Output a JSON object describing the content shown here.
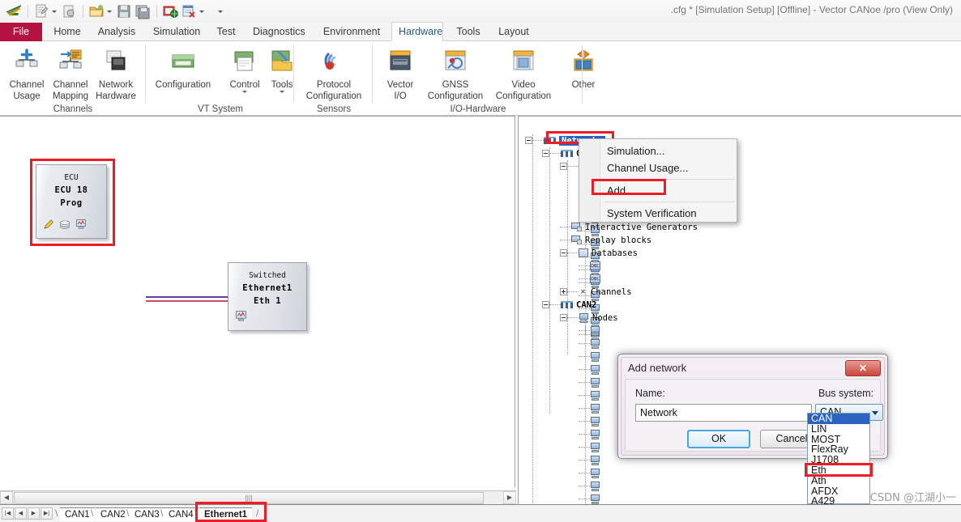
{
  "window": {
    "title": ".cfg * [Simulation Setup] [Offline] - Vector CANoe /pro (View Only)"
  },
  "quick_access": {
    "icons": [
      {
        "name": "canoe-logo-icon",
        "glyph": "✈"
      },
      {
        "name": "new-config-icon",
        "glyph": "▤"
      },
      {
        "name": "new-config-dropdown-icon",
        "glyph": "▾"
      },
      {
        "name": "open-recent-icon",
        "glyph": "◍"
      },
      {
        "name": "open-folder-icon",
        "glyph": "📂"
      },
      {
        "name": "open-dropdown-icon",
        "glyph": "▾"
      },
      {
        "name": "save-icon",
        "glyph": "💾"
      },
      {
        "name": "save-all-icon",
        "glyph": "🖫"
      },
      {
        "name": "save-as-icon",
        "glyph": "🗔"
      },
      {
        "name": "print-icon",
        "glyph": "🖨"
      },
      {
        "name": "print-dropdown-icon",
        "glyph": "▾"
      },
      {
        "name": "customize-qat-icon",
        "glyph": "▾"
      }
    ]
  },
  "ribbon": {
    "tabs": [
      {
        "label": "File",
        "kind": "file"
      },
      {
        "label": "Home",
        "kind": "normal"
      },
      {
        "label": "Analysis",
        "kind": "normal"
      },
      {
        "label": "Simulation",
        "kind": "normal"
      },
      {
        "label": "Test",
        "kind": "normal"
      },
      {
        "label": "Diagnostics",
        "kind": "normal"
      },
      {
        "label": "Environment",
        "kind": "normal"
      },
      {
        "label": "Hardware",
        "kind": "active"
      },
      {
        "label": "Tools",
        "kind": "normal"
      },
      {
        "label": "Layout",
        "kind": "normal"
      }
    ],
    "groups": [
      {
        "caption": "Channels",
        "buttons": [
          {
            "label_line1": "Channel",
            "label_line2": "Usage",
            "icon": "channel-usage-icon",
            "has_caret": false
          },
          {
            "label_line1": "Channel",
            "label_line2": "Mapping",
            "icon": "channel-mapping-icon",
            "has_caret": false
          },
          {
            "label_line1": "Network",
            "label_line2": "Hardware",
            "icon": "network-hardware-icon",
            "has_caret": false
          }
        ]
      },
      {
        "caption": "VT System",
        "buttons": [
          {
            "label_line1": "Configuration",
            "label_line2": "",
            "icon": "vt-configuration-icon",
            "has_caret": false
          },
          {
            "label_line1": "Control",
            "label_line2": "",
            "icon": "vt-control-icon",
            "has_caret": true
          },
          {
            "label_line1": "Tools",
            "label_line2": "",
            "icon": "vt-tools-icon",
            "has_caret": true
          }
        ]
      },
      {
        "caption": "Sensors",
        "buttons": [
          {
            "label_line1": "Protocol",
            "label_line2": "Configuration",
            "icon": "protocol-configuration-icon",
            "has_caret": false
          }
        ]
      },
      {
        "caption": "I/O-Hardware",
        "buttons": [
          {
            "label_line1": "Vector",
            "label_line2": "I/O",
            "icon": "vector-io-icon",
            "has_caret": false
          },
          {
            "label_line1": "GNSS",
            "label_line2": "Configuration",
            "icon": "gnss-configuration-icon",
            "has_caret": false
          },
          {
            "label_line1": "Video",
            "label_line2": "Configuration",
            "icon": "video-configuration-icon",
            "has_caret": false
          },
          {
            "label_line1": "Other",
            "label_line2": "",
            "icon": "other-io-icon",
            "has_caret": false
          }
        ]
      }
    ]
  },
  "canvas": {
    "blocks": [
      {
        "name": "ecu-block",
        "line1": "ECU",
        "line2": "ECU 18",
        "line3": "Prog",
        "icons": [
          "pencil-icon",
          "layers-icon",
          "measurement-icon"
        ],
        "highlighted": true
      },
      {
        "name": "ethernet-block",
        "line1": "Switched",
        "line2": "Ethernet1",
        "line3": "Eth 1",
        "icons": [
          "measurement-icon"
        ],
        "highlighted": false
      }
    ]
  },
  "tree": {
    "root": {
      "label": "Networks",
      "selected": true,
      "icon": "network-icon"
    },
    "nodes": [
      {
        "label": "CAN1",
        "icon": "network-icon",
        "depth": 1,
        "bold": true
      },
      {
        "label": "Nodes",
        "icon": "pc-icon",
        "depth": 2,
        "bold": false
      },
      {
        "label": "Interactive Generators",
        "icon": "generator-icon",
        "depth": 2,
        "bold": false
      },
      {
        "label": "Replay blocks",
        "icon": "generator-icon",
        "depth": 2,
        "bold": false
      },
      {
        "label": "Databases",
        "icon": "square-icon",
        "depth": 2,
        "bold": false
      },
      {
        "label": "Channels",
        "icon": "x-icon",
        "depth": 2,
        "bold": false
      },
      {
        "label": "CAN2",
        "icon": "network-icon",
        "depth": 1,
        "bold": true
      },
      {
        "label": "Nodes",
        "icon": "pc-icon",
        "depth": 2,
        "bold": false
      }
    ]
  },
  "context_menu": {
    "items": [
      {
        "label": "Simulation...",
        "highlighted": false
      },
      {
        "label": "Channel Usage...",
        "highlighted": false
      },
      {
        "label": "Add...",
        "highlighted": true
      },
      {
        "label": "System Verification",
        "highlighted": false
      }
    ]
  },
  "dialog": {
    "title": "Add network",
    "close_label": "✕",
    "name_label": "Name:",
    "name_value": "Network",
    "bus_label": "Bus system:",
    "bus_value": "CAN",
    "ok_label": "OK",
    "cancel_label": "Cancel",
    "bus_options": [
      {
        "label": "CAN",
        "state": "selected"
      },
      {
        "label": "LIN",
        "state": "normal"
      },
      {
        "label": "MOST",
        "state": "normal"
      },
      {
        "label": "FlexRay",
        "state": "normal"
      },
      {
        "label": "J1708",
        "state": "normal"
      },
      {
        "label": "Eth",
        "state": "highlighted"
      },
      {
        "label": "Ath",
        "state": "normal"
      },
      {
        "label": "AFDX",
        "state": "normal"
      },
      {
        "label": "A429",
        "state": "normal"
      }
    ]
  },
  "bottom": {
    "scroll_left": "◀",
    "scroll_right": "▶",
    "thumb_grip": "||||",
    "nav_buttons": [
      "|◀",
      "◀",
      "▶",
      "▶|"
    ],
    "sheet_tabs": [
      {
        "label": "CAN1",
        "active": false
      },
      {
        "label": "CAN2",
        "active": false
      },
      {
        "label": "CAN3",
        "active": false
      },
      {
        "label": "CAN4",
        "active": false
      },
      {
        "label": "Ethernet1",
        "active": true
      }
    ]
  },
  "watermark": {
    "text": "CSDN @江湖小一"
  },
  "colors": {
    "file_tab": "#b5123f",
    "highlight_red": "#ee1c25",
    "tree_selection": "#2a63c0",
    "accent_blue": "#4aa6e0"
  }
}
